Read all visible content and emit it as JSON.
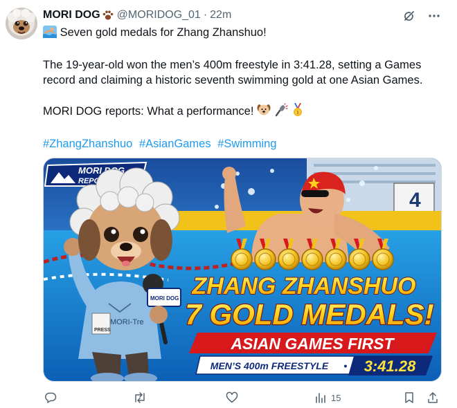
{
  "author": {
    "display_name": "MORI DOG",
    "handle": "@MORIDOG_01",
    "separator": "·",
    "time": "22m",
    "name_badge_icon": "paw-print-icon"
  },
  "tweet": {
    "headline_emoji": "swimmer-icon",
    "headline": "Seven gold medals for Zhang Zhanshuo!",
    "body_line1": "The 19-year-old won the men’s 400m freestyle in 3:41.28, setting a Games",
    "body_line2": "record and claiming a historic seventh swimming gold at one Asian Games.",
    "reports": "MORI DOG reports: What a performance!",
    "reports_emojis": [
      "dog-face-icon",
      "microphone-icon",
      "gold-medal-icon"
    ],
    "hashtags": [
      "#ZhangZhanshuo",
      "#AsianGames",
      "#Swimming"
    ]
  },
  "media": {
    "badge_line1": "MORI DOG",
    "badge_line2": "REPORT",
    "lane_number": "4",
    "shirt_text": "MORI-Tre",
    "press_tag": "PRESS",
    "mic_label": "MORI DOG",
    "title_line1": "ZHANG ZHANSHUO",
    "title_line2": "7 GOLD MEDALS!",
    "title_line3": "ASIAN GAMES FIRST",
    "event": "MEN’S 400m FREESTYLE",
    "event_sep": "•",
    "result_time": "3:41.28",
    "medal_count": 7
  },
  "actions": {
    "reply_icon": "reply-icon",
    "retweet_icon": "retweet-icon",
    "like_icon": "heart-icon",
    "views_icon": "views-chart-icon",
    "views_count": "15",
    "bookmark_icon": "bookmark-icon",
    "share_icon": "share-icon"
  },
  "top_icons": [
    "grok-icon",
    "more-options-icon"
  ],
  "colors": {
    "link": "#1d9bf0",
    "muted": "#536471",
    "text": "#0f1419",
    "gold": "#f5c518",
    "headline_yellow": "#ffe23a",
    "red_banner": "#d7191c",
    "navy_banner": "#0d2a7a"
  }
}
